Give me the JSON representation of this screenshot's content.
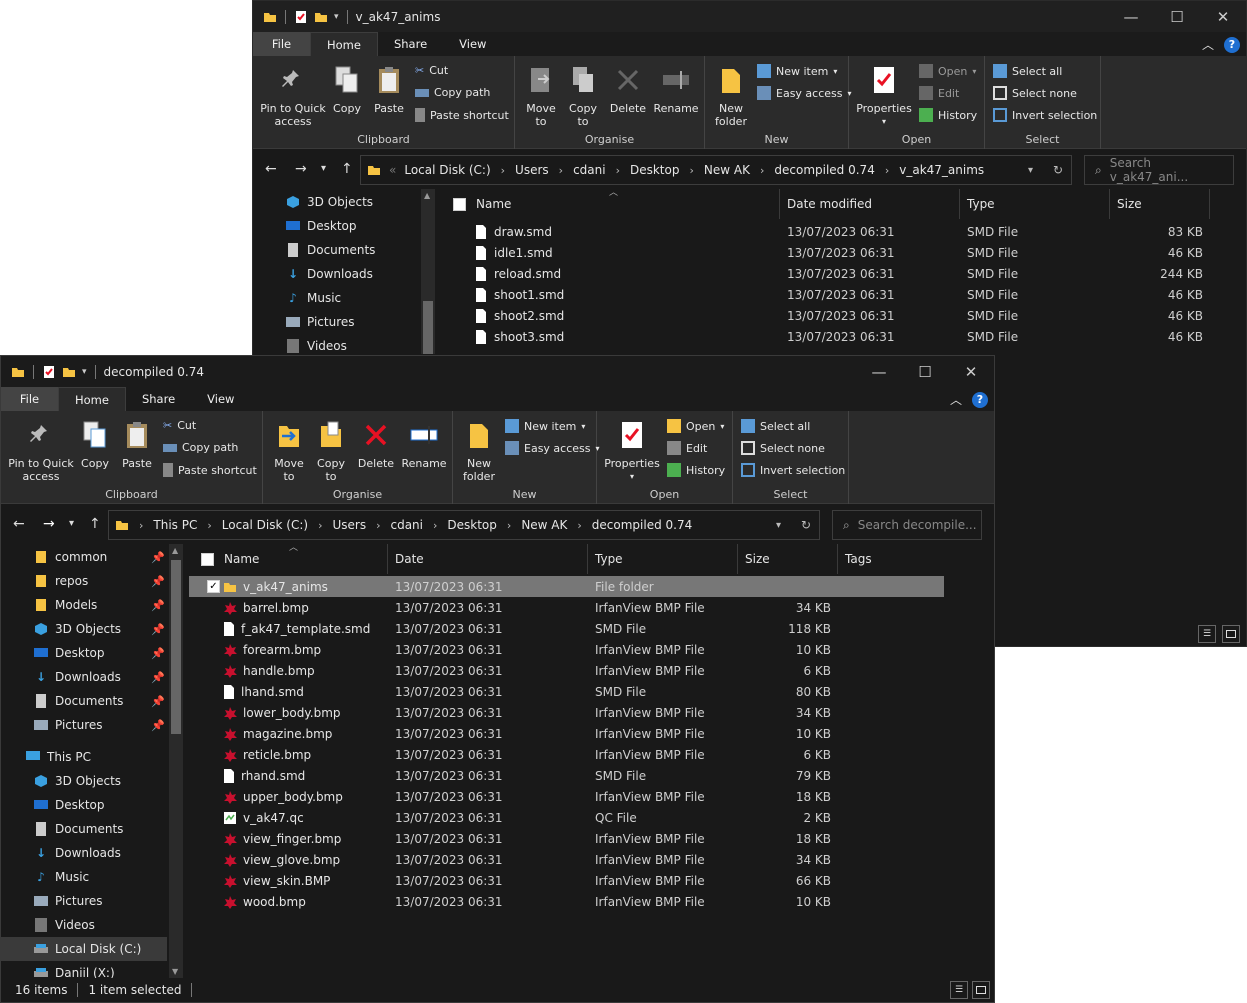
{
  "back_window": {
    "title": "v_ak47_anims",
    "tabs": [
      "File",
      "Home",
      "Share",
      "View"
    ],
    "ribbon": {
      "pin_to_quick": "Pin to Quick\naccess",
      "copy": "Copy",
      "paste": "Paste",
      "cut": "Cut",
      "copy_path": "Copy path",
      "paste_shortcut": "Paste shortcut",
      "clipboard_label": "Clipboard",
      "move_to": "Move\nto",
      "copy_to": "Copy\nto",
      "delete": "Delete",
      "rename": "Rename",
      "organise_label": "Organise",
      "new_folder": "New\nfolder",
      "new_item": "New item",
      "easy_access": "Easy access",
      "new_label": "New",
      "properties": "Properties",
      "open": "Open",
      "edit": "Edit",
      "history": "History",
      "open_label": "Open",
      "select_all": "Select all",
      "select_none": "Select none",
      "invert_selection": "Invert selection",
      "select_label": "Select"
    },
    "breadcrumb": [
      "Local Disk (C:)",
      "Users",
      "cdani",
      "Desktop",
      "New AK",
      "decompiled 0.74",
      "v_ak47_anims"
    ],
    "search_placeholder": "Search v_ak47_ani...",
    "nav_items": [
      "3D Objects",
      "Desktop",
      "Documents",
      "Downloads",
      "Music",
      "Pictures",
      "Videos"
    ],
    "columns": [
      "Name",
      "Date modified",
      "Type",
      "Size"
    ],
    "files": [
      {
        "name": "draw.smd",
        "date": "13/07/2023 06:31",
        "type": "SMD File",
        "size": "83 KB"
      },
      {
        "name": "idle1.smd",
        "date": "13/07/2023 06:31",
        "type": "SMD File",
        "size": "46 KB"
      },
      {
        "name": "reload.smd",
        "date": "13/07/2023 06:31",
        "type": "SMD File",
        "size": "244 KB"
      },
      {
        "name": "shoot1.smd",
        "date": "13/07/2023 06:31",
        "type": "SMD File",
        "size": "46 KB"
      },
      {
        "name": "shoot2.smd",
        "date": "13/07/2023 06:31",
        "type": "SMD File",
        "size": "46 KB"
      },
      {
        "name": "shoot3.smd",
        "date": "13/07/2023 06:31",
        "type": "SMD File",
        "size": "46 KB"
      }
    ]
  },
  "front_window": {
    "title": "decompiled 0.74",
    "tabs": [
      "File",
      "Home",
      "Share",
      "View"
    ],
    "breadcrumb": [
      "This PC",
      "Local Disk (C:)",
      "Users",
      "cdani",
      "Desktop",
      "New AK",
      "decompiled 0.74"
    ],
    "search_placeholder": "Search decompile...",
    "quick_access": [
      "common",
      "repos",
      "Models",
      "3D Objects",
      "Desktop",
      "Downloads",
      "Documents",
      "Pictures"
    ],
    "this_pc_label": "This PC",
    "this_pc_items": [
      "3D Objects",
      "Desktop",
      "Documents",
      "Downloads",
      "Music",
      "Pictures",
      "Videos",
      "Local Disk (C:)",
      "Daniil (X:)"
    ],
    "columns": [
      "Name",
      "Date",
      "Type",
      "Size",
      "Tags"
    ],
    "files": [
      {
        "name": "v_ak47_anims",
        "date": "13/07/2023 06:31",
        "type": "File folder",
        "size": "",
        "kind": "folder"
      },
      {
        "name": "barrel.bmp",
        "date": "13/07/2023 06:31",
        "type": "IrfanView BMP File",
        "size": "34 KB",
        "kind": "bmp"
      },
      {
        "name": "f_ak47_template.smd",
        "date": "13/07/2023 06:31",
        "type": "SMD File",
        "size": "118 KB",
        "kind": "doc"
      },
      {
        "name": "forearm.bmp",
        "date": "13/07/2023 06:31",
        "type": "IrfanView BMP File",
        "size": "10 KB",
        "kind": "bmp"
      },
      {
        "name": "handle.bmp",
        "date": "13/07/2023 06:31",
        "type": "IrfanView BMP File",
        "size": "6 KB",
        "kind": "bmp"
      },
      {
        "name": "lhand.smd",
        "date": "13/07/2023 06:31",
        "type": "SMD File",
        "size": "80 KB",
        "kind": "doc"
      },
      {
        "name": "lower_body.bmp",
        "date": "13/07/2023 06:31",
        "type": "IrfanView BMP File",
        "size": "34 KB",
        "kind": "bmp"
      },
      {
        "name": "magazine.bmp",
        "date": "13/07/2023 06:31",
        "type": "IrfanView BMP File",
        "size": "10 KB",
        "kind": "bmp"
      },
      {
        "name": "reticle.bmp",
        "date": "13/07/2023 06:31",
        "type": "IrfanView BMP File",
        "size": "6 KB",
        "kind": "bmp"
      },
      {
        "name": "rhand.smd",
        "date": "13/07/2023 06:31",
        "type": "SMD File",
        "size": "79 KB",
        "kind": "doc"
      },
      {
        "name": "upper_body.bmp",
        "date": "13/07/2023 06:31",
        "type": "IrfanView BMP File",
        "size": "18 KB",
        "kind": "bmp"
      },
      {
        "name": "v_ak47.qc",
        "date": "13/07/2023 06:31",
        "type": "QC File",
        "size": "2 KB",
        "kind": "qc"
      },
      {
        "name": "view_finger.bmp",
        "date": "13/07/2023 06:31",
        "type": "IrfanView BMP File",
        "size": "18 KB",
        "kind": "bmp"
      },
      {
        "name": "view_glove.bmp",
        "date": "13/07/2023 06:31",
        "type": "IrfanView BMP File",
        "size": "34 KB",
        "kind": "bmp"
      },
      {
        "name": "view_skin.BMP",
        "date": "13/07/2023 06:31",
        "type": "IrfanView BMP File",
        "size": "66 KB",
        "kind": "bmp"
      },
      {
        "name": "wood.bmp",
        "date": "13/07/2023 06:31",
        "type": "IrfanView BMP File",
        "size": "10 KB",
        "kind": "bmp"
      }
    ],
    "status_items": "16 items",
    "status_selected": "1 item selected"
  },
  "colors": {
    "folder": "#f6c343",
    "accent_blue": "#1f6fd1",
    "delete_red": "#e81123",
    "bmp_red": "#c8102e"
  }
}
